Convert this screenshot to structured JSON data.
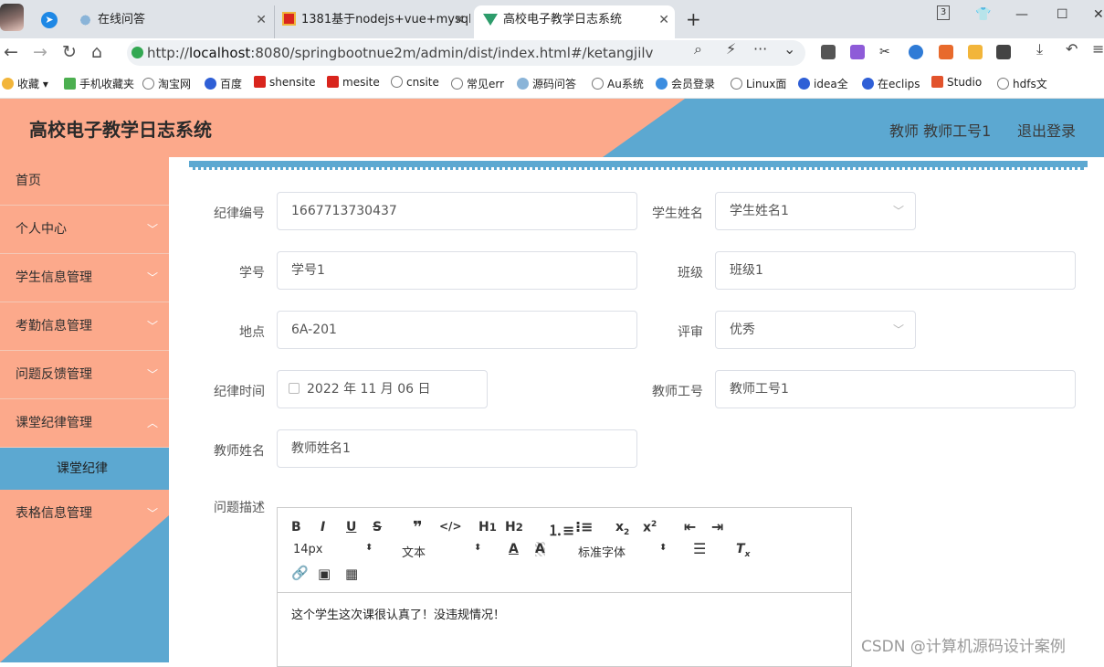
{
  "browser": {
    "tabs": [
      {
        "title": "在线问答"
      },
      {
        "title": "1381基于nodejs+vue+mysql"
      },
      {
        "title": "高校电子教学日志系统"
      }
    ],
    "tab_count_badge": "3",
    "url_prefix": "http://",
    "url_host": "localhost",
    "url_rest": ":8080/springbootnue2m/admin/dist/index.html#/ketangjilv",
    "bookmarks": [
      "收藏",
      "手机收藏夹",
      "淘宝网",
      "百度",
      "shensite",
      "mesite",
      "cnsite",
      "常见err",
      "源码问答",
      "Au系统",
      "会员登录",
      "Linux面",
      "idea全",
      "在eclips",
      "Studio",
      "hdfs文"
    ]
  },
  "header": {
    "title": "高校电子教学日志系统",
    "user": "教师 教师工号1",
    "logout": "退出登录"
  },
  "sidebar": {
    "items": [
      {
        "label": "首页"
      },
      {
        "label": "个人中心"
      },
      {
        "label": "学生信息管理"
      },
      {
        "label": "考勤信息管理"
      },
      {
        "label": "问题反馈管理"
      },
      {
        "label": "课堂纪律管理"
      },
      {
        "label": "表格信息管理"
      }
    ],
    "active_subitem": "课堂纪律"
  },
  "form": {
    "discipline_no": {
      "label": "纪律编号",
      "value": "1667713730437"
    },
    "student_name": {
      "label": "学生姓名",
      "value": "学生姓名1"
    },
    "student_id": {
      "label": "学号",
      "value": "学号1"
    },
    "class": {
      "label": "班级",
      "value": "班级1"
    },
    "location": {
      "label": "地点",
      "value": "6A-201"
    },
    "rating": {
      "label": "评审",
      "value": "优秀"
    },
    "time": {
      "label": "纪律时间",
      "value": "2022 年 11 月 06 日"
    },
    "teacher_id": {
      "label": "教师工号",
      "value": "教师工号1"
    },
    "teacher_name": {
      "label": "教师姓名",
      "value": "教师姓名1"
    },
    "description": {
      "label": "问题描述",
      "value": "这个学生这次课很认真了！没违规情况！"
    }
  },
  "editor_toolbar": {
    "font_size": "14px",
    "header_select": "文本",
    "font_family": "标准字体"
  },
  "watermark": "CSDN @计算机源码设计案例"
}
